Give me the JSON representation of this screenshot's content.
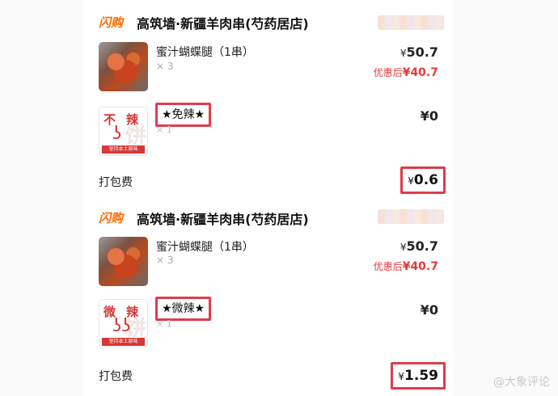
{
  "orders": [
    {
      "brand": "闪购",
      "store_name": "高筑墙·新疆羊肉串(芍药居店)",
      "item": {
        "name": "蜜汁蝴蝶腿（1串）",
        "qty": "× 3",
        "price": "50.7",
        "discount_label": "优惠后",
        "discount_price": "¥40.7"
      },
      "option": {
        "name": "★免辣★",
        "qty": "× 1",
        "price": "0",
        "thumb_text_1": "不",
        "thumb_text_2": "辣",
        "thumb_watermark": "饼",
        "thumb_band": "坚持本土原味"
      },
      "fee": {
        "label": "打包费",
        "amount": "0.6"
      }
    },
    {
      "brand": "闪购",
      "store_name": "高筑墙·新疆羊肉串(芍药居店)",
      "item": {
        "name": "蜜汁蝴蝶腿（1串）",
        "qty": "× 3",
        "price": "50.7",
        "discount_label": "优惠后",
        "discount_price": "¥40.7"
      },
      "option": {
        "name": "★微辣★",
        "qty": "× 1",
        "price": "0",
        "thumb_text_1": "微",
        "thumb_text_2": "辣",
        "thumb_watermark": "饼",
        "thumb_band": "坚持本土原味"
      },
      "fee": {
        "label": "打包费",
        "amount": "1.59"
      }
    }
  ],
  "currency": "¥",
  "watermark": "@大象评论",
  "colors": {
    "brand": "#ff6a00",
    "discount": "#e43b3b",
    "highlight_box": "#e03c4b",
    "chili": "#d93636"
  }
}
